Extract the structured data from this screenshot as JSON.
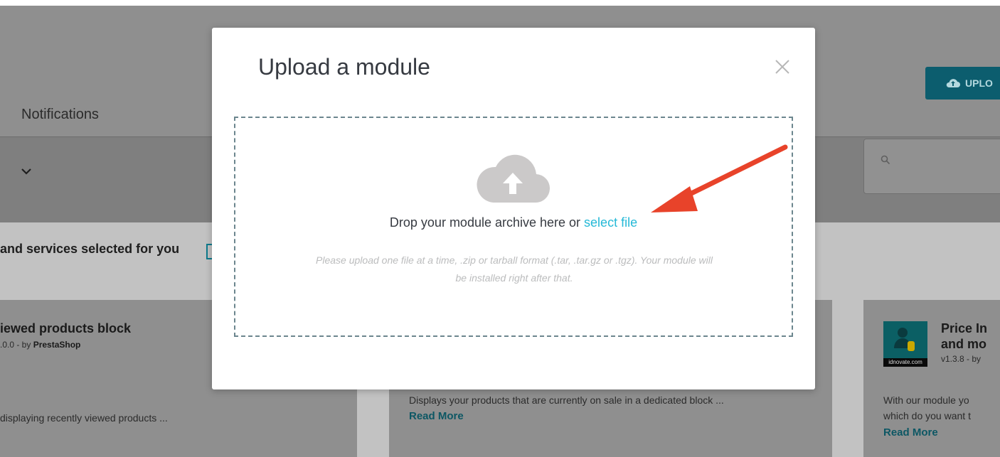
{
  "background": {
    "notifications_label": "Notifications",
    "upload_button_label": "UPLO",
    "section_title": "and services selected for you",
    "cards": [
      {
        "title": "iewed products block",
        "meta_version": ".0.0 - by ",
        "meta_author": "PrestaShop",
        "description": "displaying recently viewed products ..."
      },
      {
        "description": "Displays your products that are currently on sale in a dedicated block ...",
        "read_more": "Read More"
      },
      {
        "title_line1": "Price In",
        "title_line2": "and mo",
        "meta_version": "v1.3.8 - by",
        "logo_text": "idnovate.com",
        "description_line1": "With our module yo",
        "description_line2": "which do you want t",
        "read_more": "Read More"
      }
    ]
  },
  "modal": {
    "title": "Upload a module",
    "drop_text": "Drop your module archive here or ",
    "select_file_link": "select file",
    "help_line1": "Please upload one file at a time, .zip or tarball format (.tar, .tar.gz or .tgz). Your module will",
    "help_line2": "be installed right after that."
  },
  "colors": {
    "link": "#25b9d7",
    "annotation_arrow": "#e8432a",
    "overlay_header": "#8f8f8f"
  }
}
